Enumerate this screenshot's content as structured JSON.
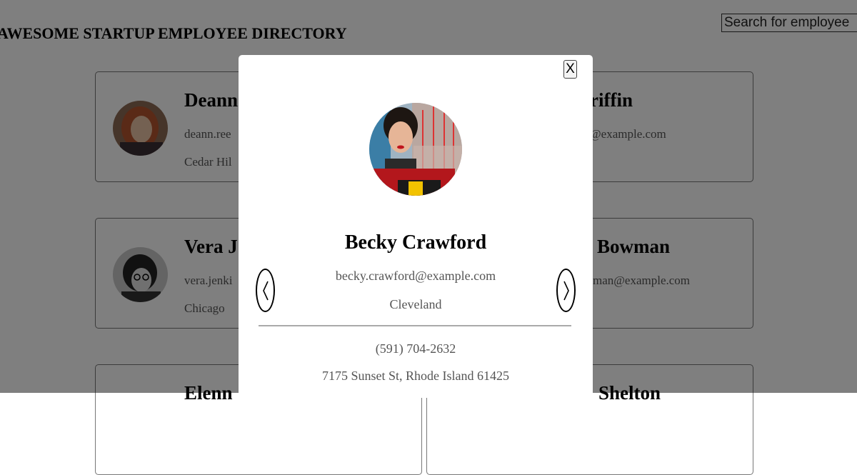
{
  "header": {
    "title": "AWESOME STARTUP EMPLOYEE DIRECTORY",
    "search_placeholder": "Search for employee"
  },
  "cards": [
    {
      "name": "Deann",
      "email": "deann.ree",
      "city": "Cedar Hil"
    },
    {
      "name": "riffin",
      "email": "@example.com",
      "city": ""
    },
    {
      "name": "Vera J",
      "email": "vera.jenki",
      "city": "Chicago"
    },
    {
      "name": "Bowman",
      "email": "man@example.com",
      "city": ""
    },
    {
      "name": "Elenn",
      "email": "",
      "city": ""
    },
    {
      "name": "Shelton",
      "email": "",
      "city": ""
    }
  ],
  "modal": {
    "close_label": "X",
    "name": "Becky Crawford",
    "email": "becky.crawford@example.com",
    "city": "Cleveland",
    "phone": "(591) 704-2632",
    "address": "7175 Sunset St, Rhode Island 61425",
    "prev_icon": "chevron-left-icon",
    "next_icon": "chevron-right-icon"
  },
  "colors": {
    "overlay": "#000000",
    "secondary_text": "#555555",
    "divider": "#aaaaaa"
  }
}
